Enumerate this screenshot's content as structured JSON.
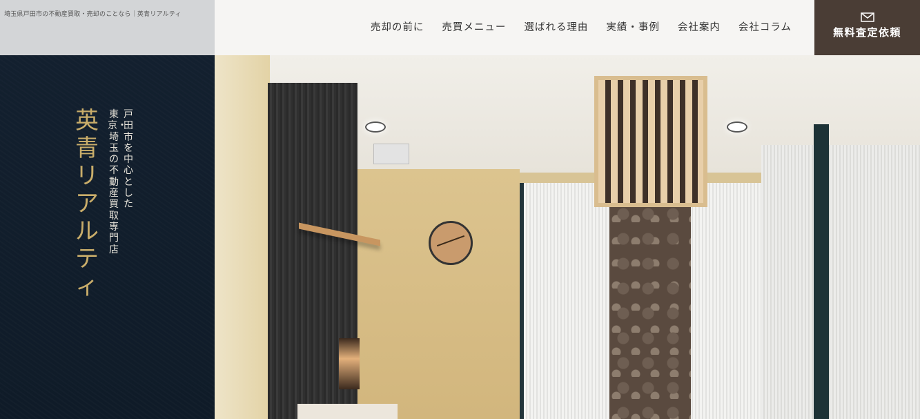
{
  "tagline": "埼玉県戸田市の不動産買取・売却のことなら｜英青リアルティ",
  "logo": "英青リアルティ",
  "sidebar_tagline": {
    "line1": "戸田市を中心とした",
    "line2": "東京・埼玉の不動産買取専門店"
  },
  "nav": {
    "items": [
      "売却の前に",
      "売買メニュー",
      "選ばれる理由",
      "実績・事例",
      "会社案内",
      "会社コラム"
    ]
  },
  "cta": {
    "icon": "mail-icon",
    "label": "無料査定依頼"
  },
  "colors": {
    "sidebar_bg": "#13202f",
    "logo_gold": "#c9ad6a",
    "cta_bg": "#4a3d35",
    "header_bg": "#f6f5f3"
  }
}
